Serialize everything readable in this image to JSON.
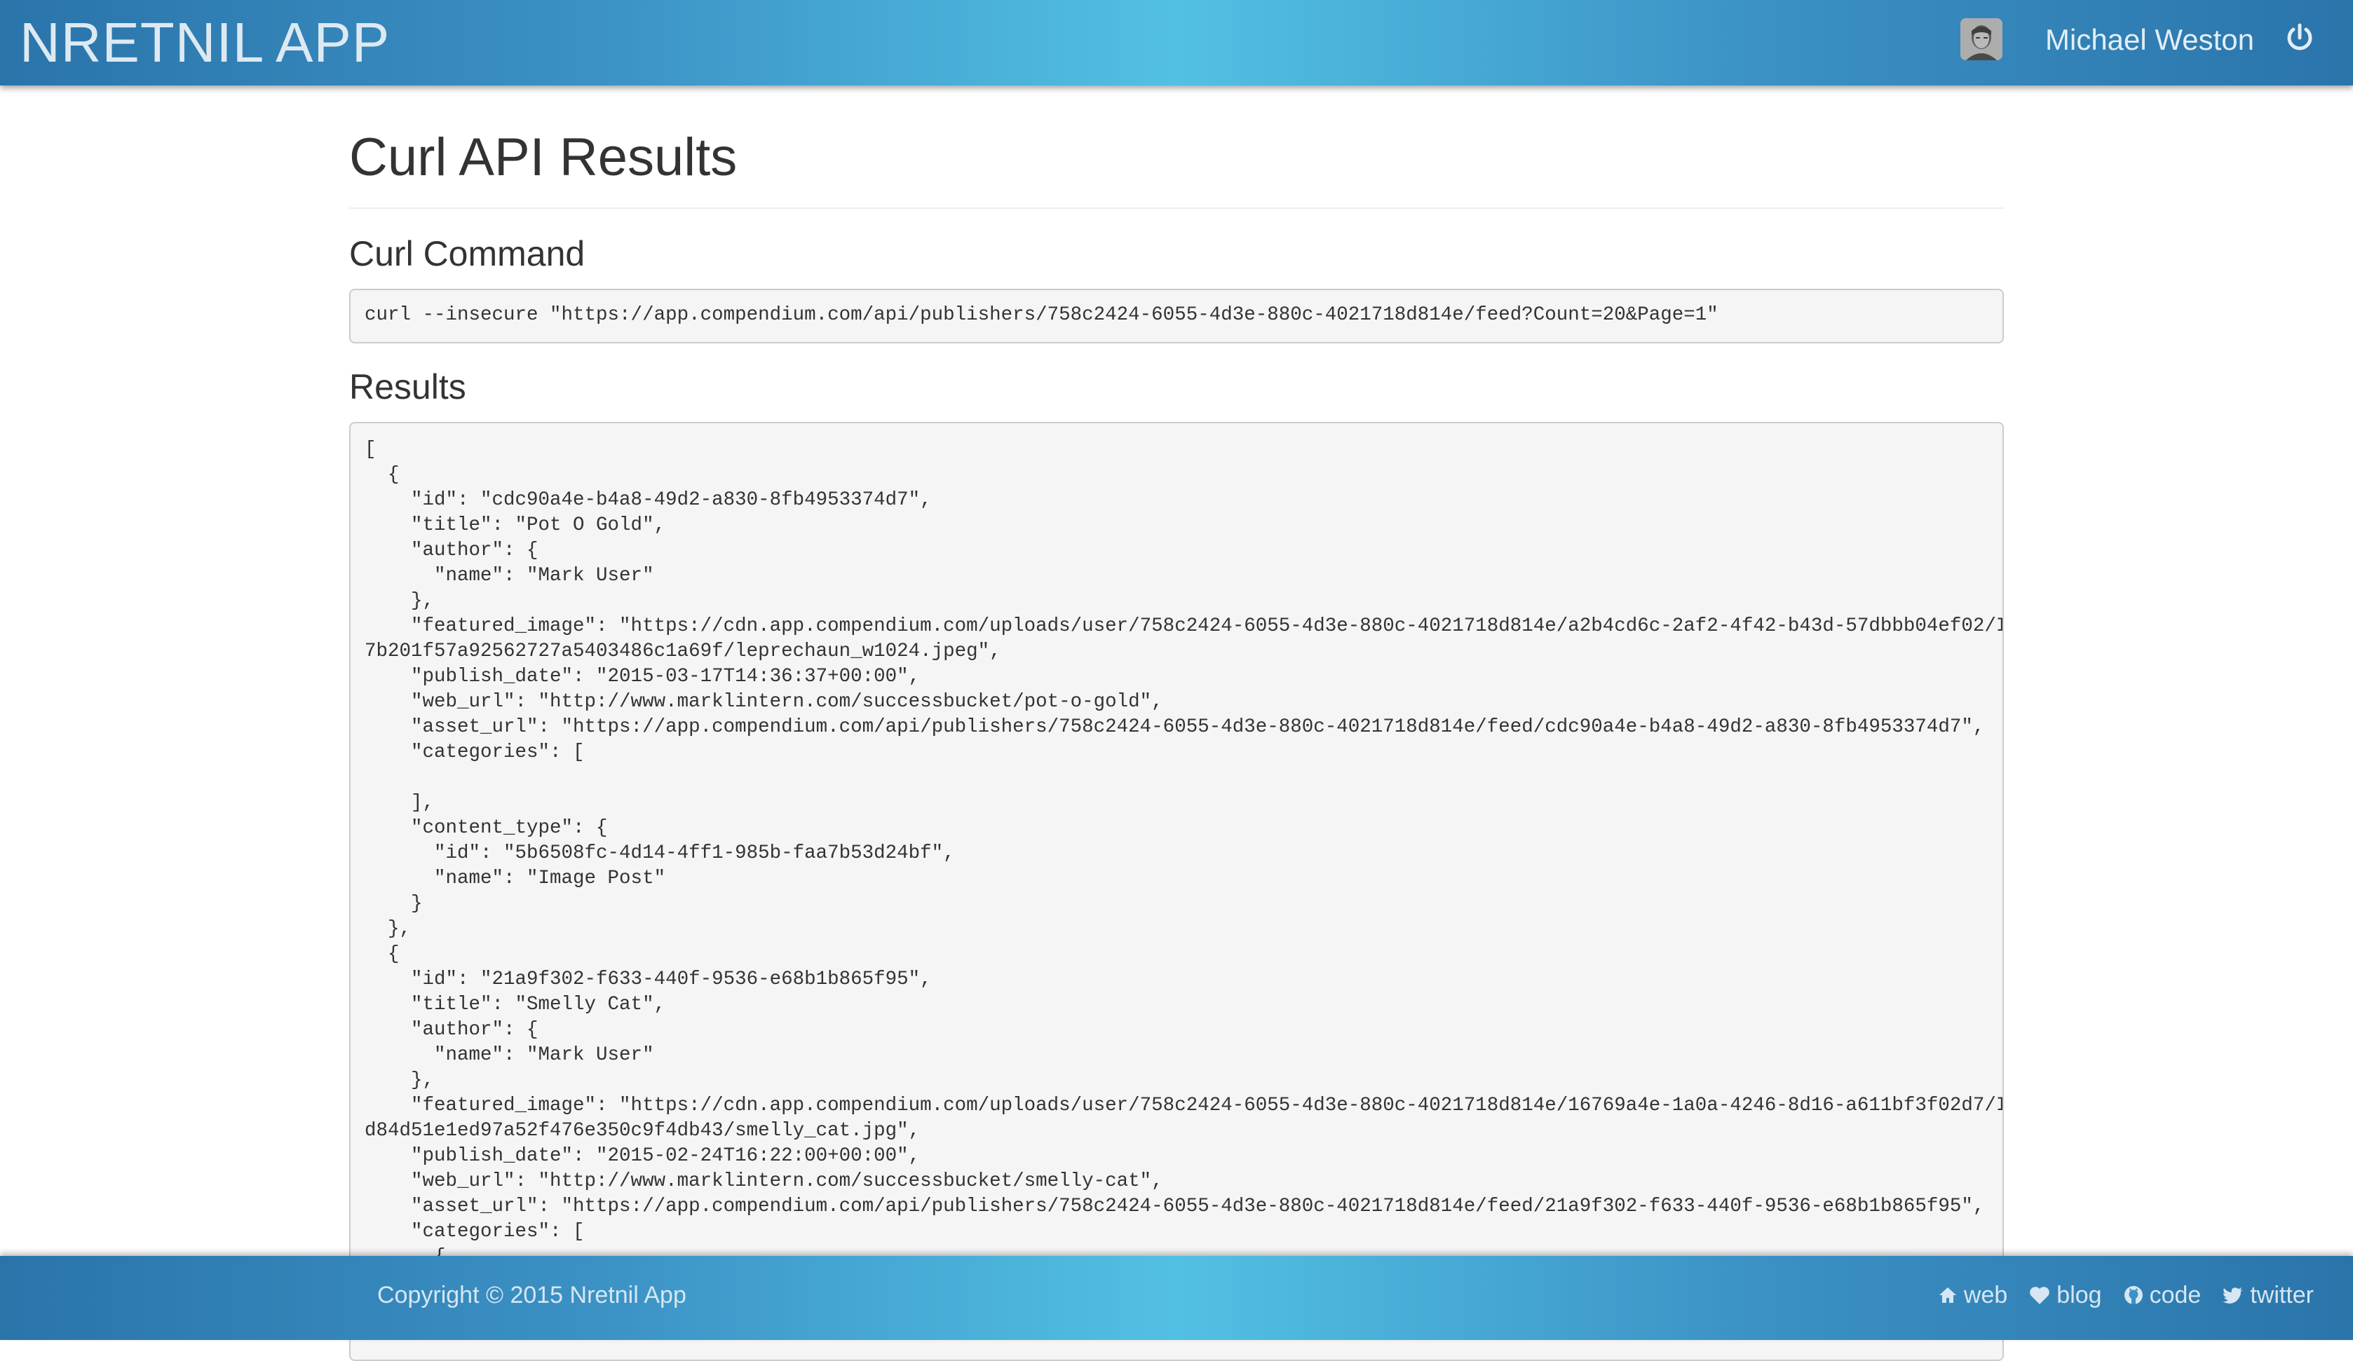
{
  "navbar": {
    "brand": "NRETNIL APP",
    "user_name": "Michael Weston",
    "avatar_icon": "user-avatar",
    "power_icon": "power-icon"
  },
  "main": {
    "page_title": "Curl API Results",
    "curl_heading": "Curl Command",
    "curl_command": "curl --insecure \"https://app.compendium.com/api/publishers/758c2424-6055-4d3e-880c-4021718d814e/feed?Count=20&Page=1\"",
    "results_heading": "Results",
    "results_text": "[\n  {\n    \"id\": \"cdc90a4e-b4a8-49d2-a830-8fb4953374d7\",\n    \"title\": \"Pot O Gold\",\n    \"author\": {\n      \"name\": \"Mark User\"\n    },\n    \"featured_image\": \"https://cdn.app.compendium.com/uploads/user/758c2424-6055-4d3e-880c-4021718d814e/a2b4cd6c-2af2-4f42-b43d-57dbbb04ef02/Image/b\n7b201f57a92562727a5403486c1a69f/leprechaun_w1024.jpeg\",\n    \"publish_date\": \"2015-03-17T14:36:37+00:00\",\n    \"web_url\": \"http://www.marklintern.com/successbucket/pot-o-gold\",\n    \"asset_url\": \"https://app.compendium.com/api/publishers/758c2424-6055-4d3e-880c-4021718d814e/feed/cdc90a4e-b4a8-49d2-a830-8fb4953374d7\",\n    \"categories\": [\n\n    ],\n    \"content_type\": {\n      \"id\": \"5b6508fc-4d14-4ff1-985b-faa7b53d24bf\",\n      \"name\": \"Image Post\"\n    }\n  },\n  {\n    \"id\": \"21a9f302-f633-440f-9536-e68b1b865f95\",\n    \"title\": \"Smelly Cat\",\n    \"author\": {\n      \"name\": \"Mark User\"\n    },\n    \"featured_image\": \"https://cdn.app.compendium.com/uploads/user/758c2424-6055-4d3e-880c-4021718d814e/16769a4e-1a0a-4246-8d16-a611bf3f02d7/Image/f\nd84d51e1ed97a52f476e350c9f4db43/smelly_cat.jpg\",\n    \"publish_date\": \"2015-02-24T16:22:00+00:00\",\n    \"web_url\": \"http://www.marklintern.com/successbucket/smelly-cat\",\n    \"asset_url\": \"https://app.compendium.com/api/publishers/758c2424-6055-4d3e-880c-4021718d814e/feed/21a9f302-f633-440f-9536-e68b1b865f95\",\n    \"categories\": [\n      {"
  },
  "footer": {
    "copyright": "Copyright © 2015 Nretnil App",
    "links": [
      {
        "label": "web",
        "icon": "home-icon"
      },
      {
        "label": "blog",
        "icon": "heart-icon"
      },
      {
        "label": "code",
        "icon": "github-icon"
      },
      {
        "label": "twitter",
        "icon": "twitter-icon"
      }
    ]
  }
}
